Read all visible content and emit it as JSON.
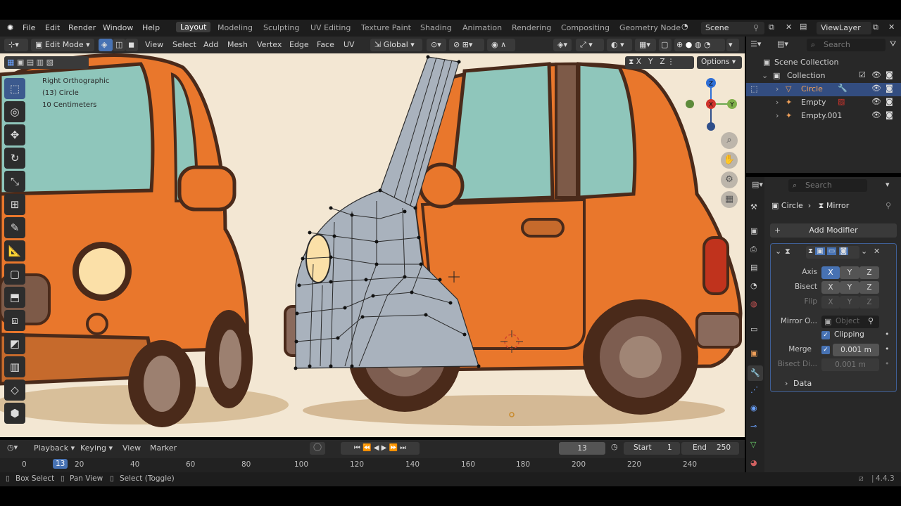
{
  "menu": {
    "items": [
      "File",
      "Edit",
      "Render",
      "Window",
      "Help"
    ],
    "workspaces": [
      "Layout",
      "Modeling",
      "Sculpting",
      "UV Editing",
      "Texture Paint",
      "Shading",
      "Animation",
      "Rendering",
      "Compositing",
      "Geometry Node"
    ],
    "scene": "Scene",
    "view_layer": "ViewLayer"
  },
  "viewport_header": {
    "mode": "Edit Mode",
    "menus": [
      "View",
      "Select",
      "Add",
      "Mesh",
      "Vertex",
      "Edge",
      "Face",
      "UV"
    ],
    "transform": "Global",
    "options": "Options",
    "mirror_axes": [
      "X",
      "Y",
      "Z"
    ]
  },
  "overlay": {
    "view_name": "Right Orthographic",
    "object": "(13) Circle",
    "scale": "10 Centimeters"
  },
  "gizmo": {
    "z": "Z",
    "x": "X",
    "y": "Y"
  },
  "outliner": {
    "search_placeholder": "Search",
    "scene_collection": "Scene Collection",
    "collection": "Collection",
    "objects": [
      "Circle",
      "Empty",
      "Empty.001"
    ]
  },
  "properties": {
    "search_placeholder": "Search",
    "breadcrumb_object": "Circle",
    "breadcrumb_modifier": "Mirror",
    "add_modifier": "Add Modifier",
    "axis_label": "Axis",
    "bisect_label": "Bisect",
    "flip_label": "Flip",
    "mirror_object_label": "Mirror O...",
    "mirror_object_placeholder": "Object",
    "clipping_label": "Clipping",
    "merge_label": "Merge",
    "merge_value": "0.001 m",
    "bisect_distance_label": "Bisect Di...",
    "bisect_distance_value": "0.001 m",
    "data_label": "Data",
    "axes": [
      "X",
      "Y",
      "Z"
    ]
  },
  "timeline": {
    "menus": [
      "Playback",
      "Keying",
      "View",
      "Marker"
    ],
    "current_frame": "13",
    "start_label": "Start",
    "start": "1",
    "end_label": "End",
    "end": "250",
    "ruler": [
      "0",
      "20",
      "40",
      "60",
      "80",
      "100",
      "120",
      "140",
      "160",
      "180",
      "200",
      "220",
      "240"
    ]
  },
  "status": {
    "box_select": "Box Select",
    "pan_view": "Pan View",
    "select_toggle": "Select (Toggle)",
    "version": "4.4.3"
  },
  "colors": {
    "accent": "#4772b3",
    "active_object": "#f1a15a",
    "car_body": "#e9772c",
    "viewport_bg": "#f3e7d3"
  }
}
